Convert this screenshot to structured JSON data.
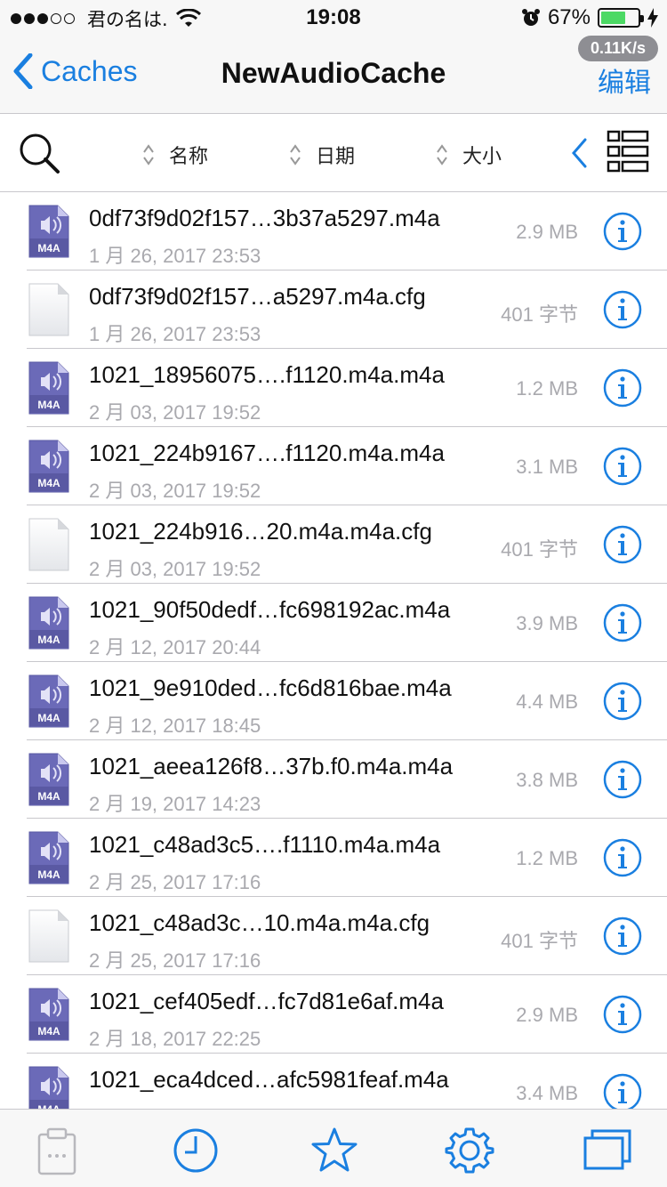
{
  "status_bar": {
    "carrier": "君の名は.",
    "time": "19:08",
    "battery": "67%",
    "battery_level": 0.67
  },
  "nav": {
    "back_label": "Caches",
    "title": "NewAudioCache",
    "edit_label": "编辑",
    "speed": "0.11K/s"
  },
  "toolbar": {
    "sort_name": "名称",
    "sort_date": "日期",
    "sort_size": "大小"
  },
  "files": [
    {
      "name": "0df73f9d02f157…3b37a5297.m4a",
      "date": "1 月 26, 2017 23:53",
      "size": "2.9 MB",
      "type": "m4a"
    },
    {
      "name": "0df73f9d02f157…a5297.m4a.cfg",
      "date": "1 月 26, 2017 23:53",
      "size": "401 字节",
      "type": "cfg"
    },
    {
      "name": "1021_18956075….f1120.m4a.m4a",
      "date": "2 月 03, 2017 19:52",
      "size": "1.2 MB",
      "type": "m4a"
    },
    {
      "name": "1021_224b9167….f1120.m4a.m4a",
      "date": "2 月 03, 2017 19:52",
      "size": "3.1 MB",
      "type": "m4a"
    },
    {
      "name": "1021_224b916…20.m4a.m4a.cfg",
      "date": "2 月 03, 2017 19:52",
      "size": "401 字节",
      "type": "cfg"
    },
    {
      "name": "1021_90f50dedf…fc698192ac.m4a",
      "date": "2 月 12, 2017 20:44",
      "size": "3.9 MB",
      "type": "m4a"
    },
    {
      "name": "1021_9e910ded…fc6d816bae.m4a",
      "date": "2 月 12, 2017 18:45",
      "size": "4.4 MB",
      "type": "m4a"
    },
    {
      "name": "1021_aeea126f8…37b.f0.m4a.m4a",
      "date": "2 月 19, 2017 14:23",
      "size": "3.8 MB",
      "type": "m4a"
    },
    {
      "name": "1021_c48ad3c5….f1110.m4a.m4a",
      "date": "2 月 25, 2017 17:16",
      "size": "1.2 MB",
      "type": "m4a"
    },
    {
      "name": "1021_c48ad3c…10.m4a.m4a.cfg",
      "date": "2 月 25, 2017 17:16",
      "size": "401 字节",
      "type": "cfg"
    },
    {
      "name": "1021_cef405edf…fc7d81e6af.m4a",
      "date": "2 月 18, 2017 22:25",
      "size": "2.9 MB",
      "type": "m4a"
    },
    {
      "name": "1021_eca4dced…afc5981feaf.m4a",
      "date": "",
      "size": "3.4 MB",
      "type": "m4a"
    }
  ],
  "icon_label": "M4A",
  "colors": {
    "accent": "#1a7fe0",
    "battery": "#4cd964",
    "secondary_text": "#a9a9ae",
    "m4a_icon": "#6b6ab8"
  },
  "tabs": [
    "clipboard-icon",
    "clock-icon",
    "star-icon",
    "gear-icon",
    "windows-icon"
  ]
}
